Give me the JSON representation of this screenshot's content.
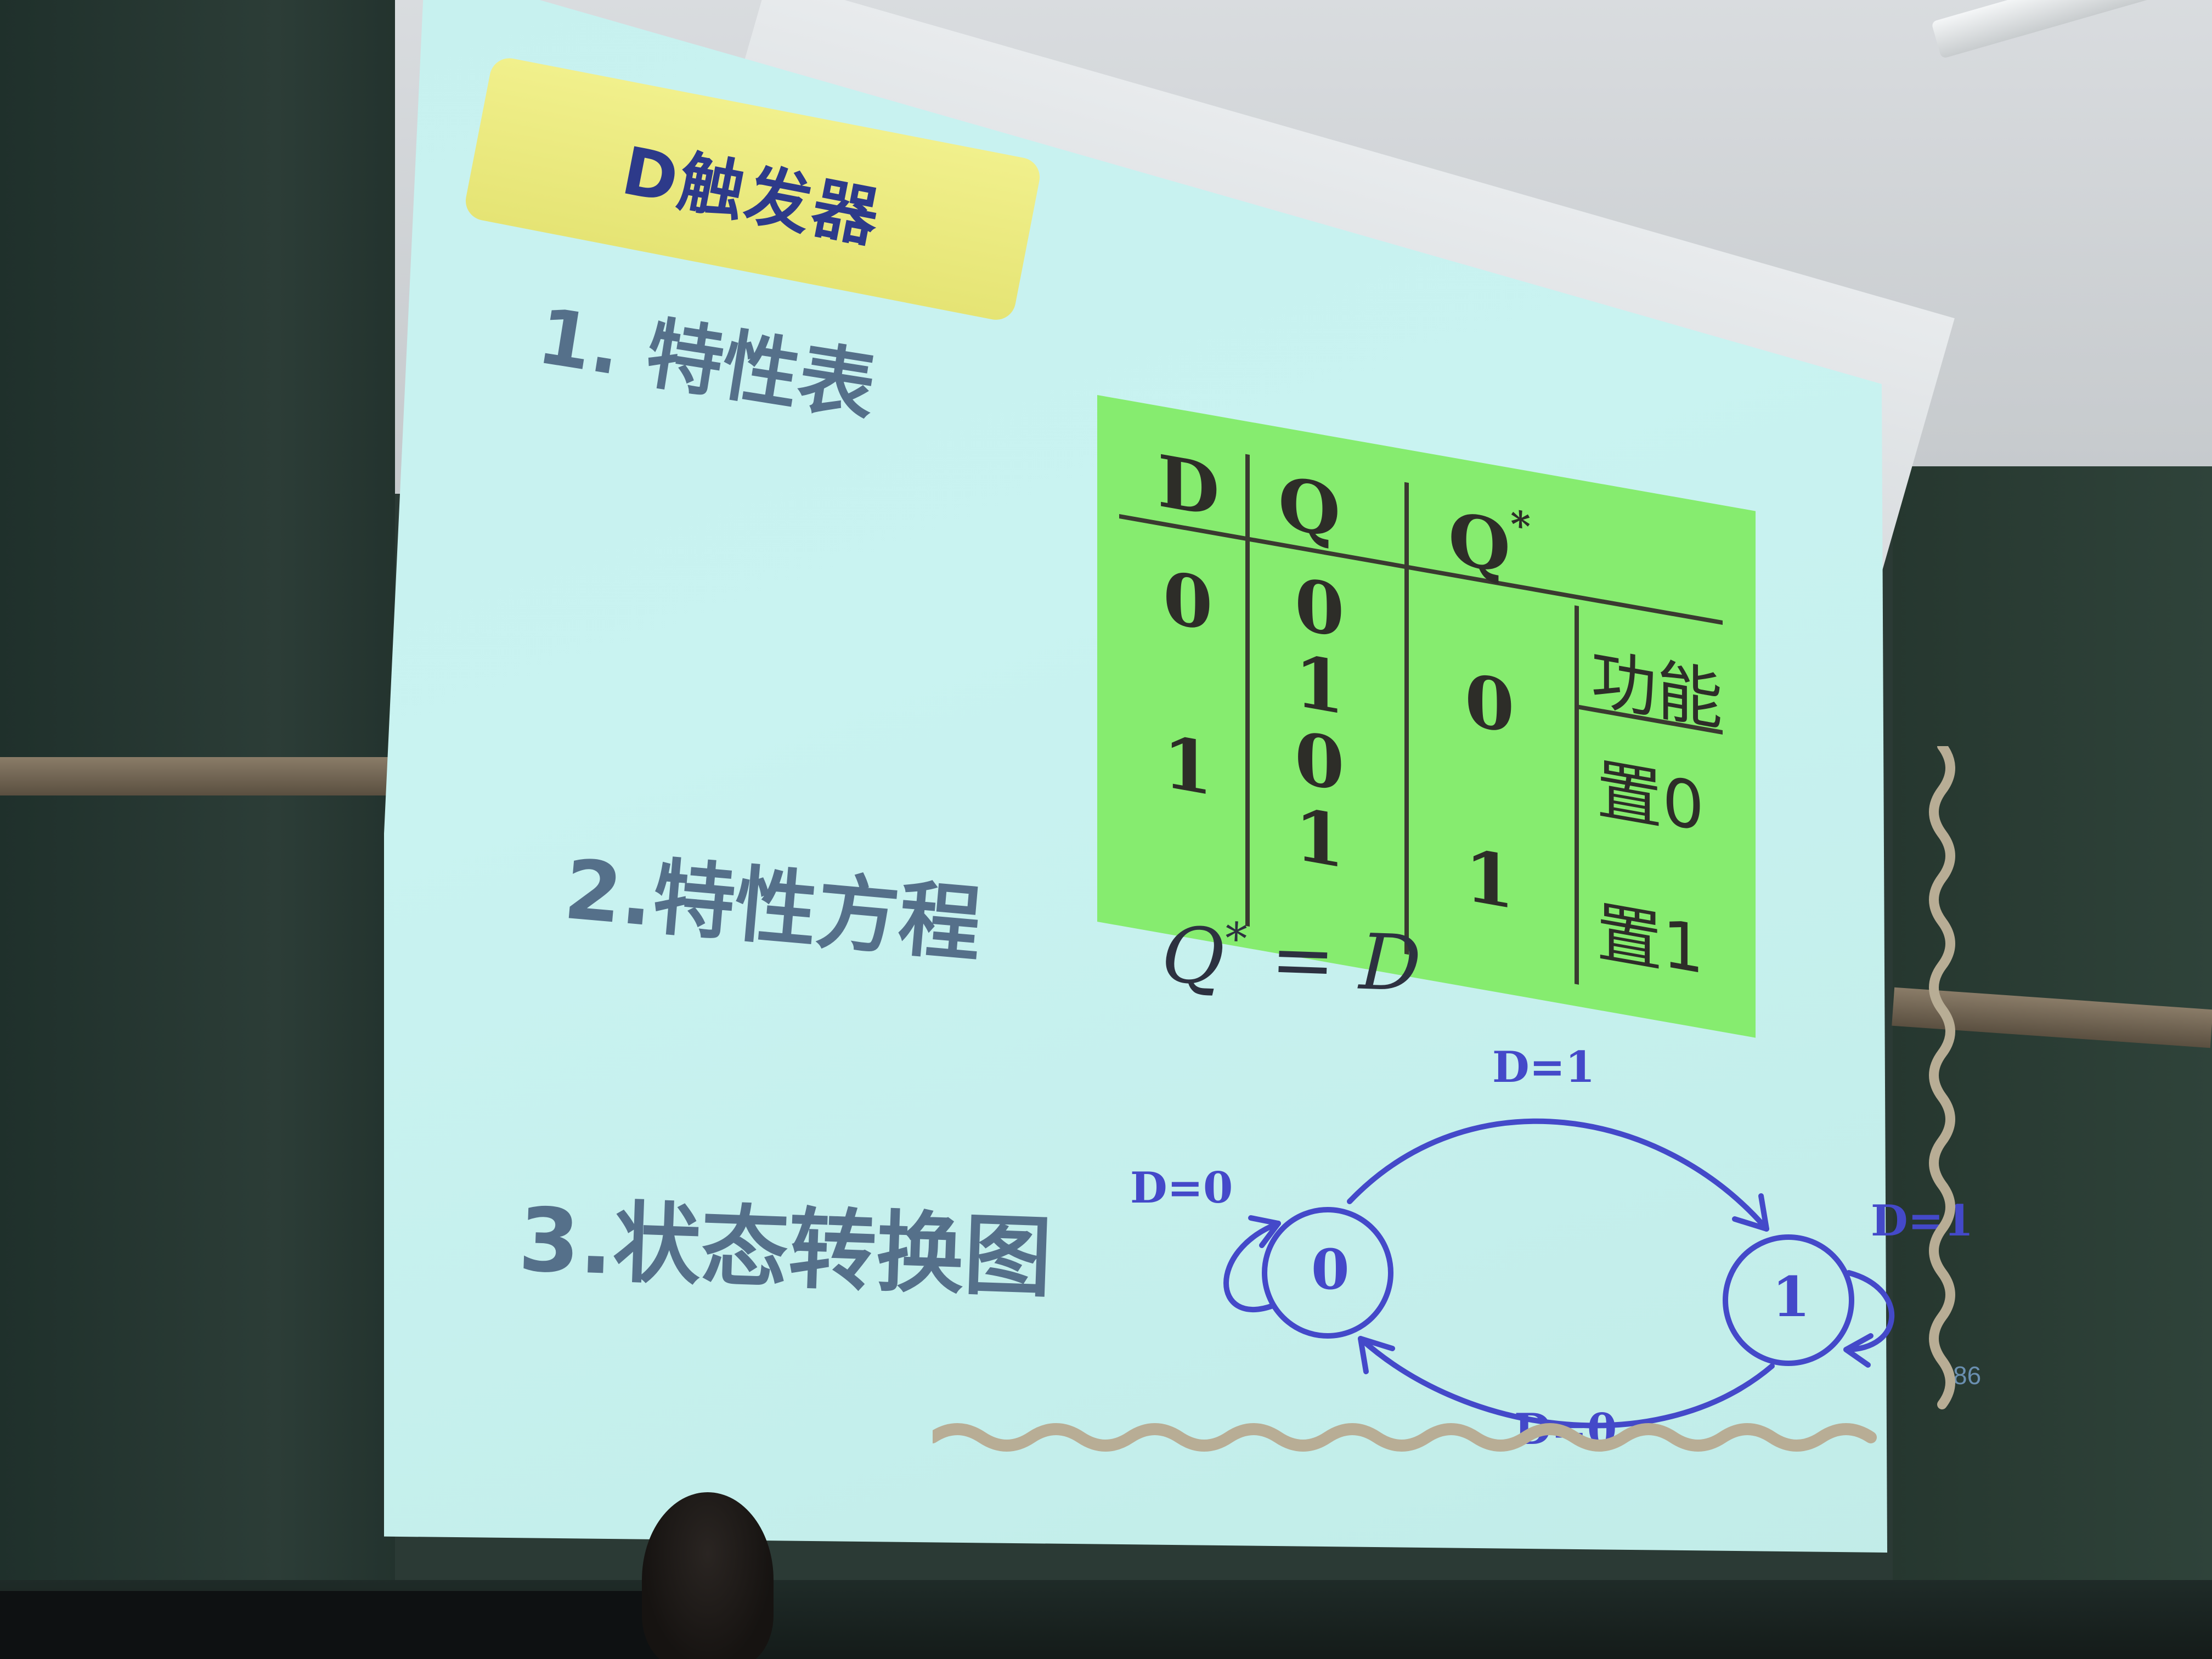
{
  "slide": {
    "title": "D触发器",
    "section1": "1. 特性表",
    "section2": "2.特性方程",
    "section3": "3.状态转换图",
    "page_number": "86"
  },
  "table": {
    "headers": [
      "D",
      "Q",
      "Q*",
      "功能"
    ],
    "header_q": "Q",
    "header_qstar_base": "Q",
    "header_qstar_sup": "*",
    "col_d": [
      "0",
      "1"
    ],
    "col_q": [
      "0",
      "1",
      "0",
      "1"
    ],
    "col_qstar": [
      "0",
      "1"
    ],
    "col_function": [
      "置0",
      "置1"
    ]
  },
  "equation": {
    "lhs_base": "Q",
    "lhs_sup": "*",
    "rest": "= D"
  },
  "state_diagram": {
    "states": [
      "0",
      "1"
    ],
    "transitions": {
      "top": "D=1",
      "bottom": "D=0",
      "self_left": "D=0",
      "self_right": "D=1"
    },
    "color": "#4449c9"
  },
  "colors": {
    "screen": "#c7f1ef",
    "title_box": "#ece97e",
    "title_text": "#2d3a8a",
    "table_bg": "#86ec6f",
    "section_text": "#55708a"
  }
}
